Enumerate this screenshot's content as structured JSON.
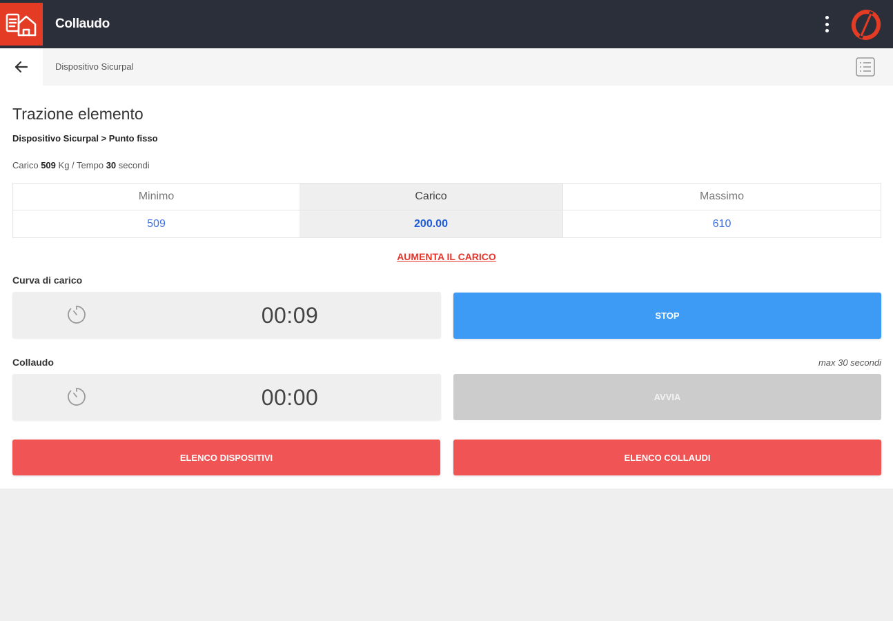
{
  "header": {
    "title": "Collaudo"
  },
  "subbar": {
    "breadcrumb": "Dispositivo Sicurpal"
  },
  "main": {
    "title": "Trazione elemento",
    "path": "Dispositivo Sicurpal > Punto fisso",
    "info": {
      "load_label": "Carico",
      "load_value": "509",
      "load_unit": "Kg / Tempo",
      "time_value": "30",
      "time_unit": "secondi"
    },
    "table": {
      "headers": [
        "Minimo",
        "Carico",
        "Massimo"
      ],
      "values": [
        "509",
        "200.00",
        "610"
      ]
    },
    "increase_link": "AUMENTA IL CARICO",
    "load_curve": {
      "label": "Curva di carico",
      "time": "00:09",
      "button": "STOP"
    },
    "test": {
      "label": "Collaudo",
      "note": "max 30 secondi",
      "time": "00:00",
      "button": "AVVIA"
    },
    "buttons": {
      "devices": "ELENCO DISPOSITIVI",
      "tests": "ELENCO COLLAUDI"
    }
  },
  "colors": {
    "topbar": "#2b2f3a",
    "logo": "#e43b24",
    "stop": "#3d9bf6",
    "disabled": "#cccccc",
    "danger": "#f05454",
    "value_blue": "#3f6fe0"
  }
}
